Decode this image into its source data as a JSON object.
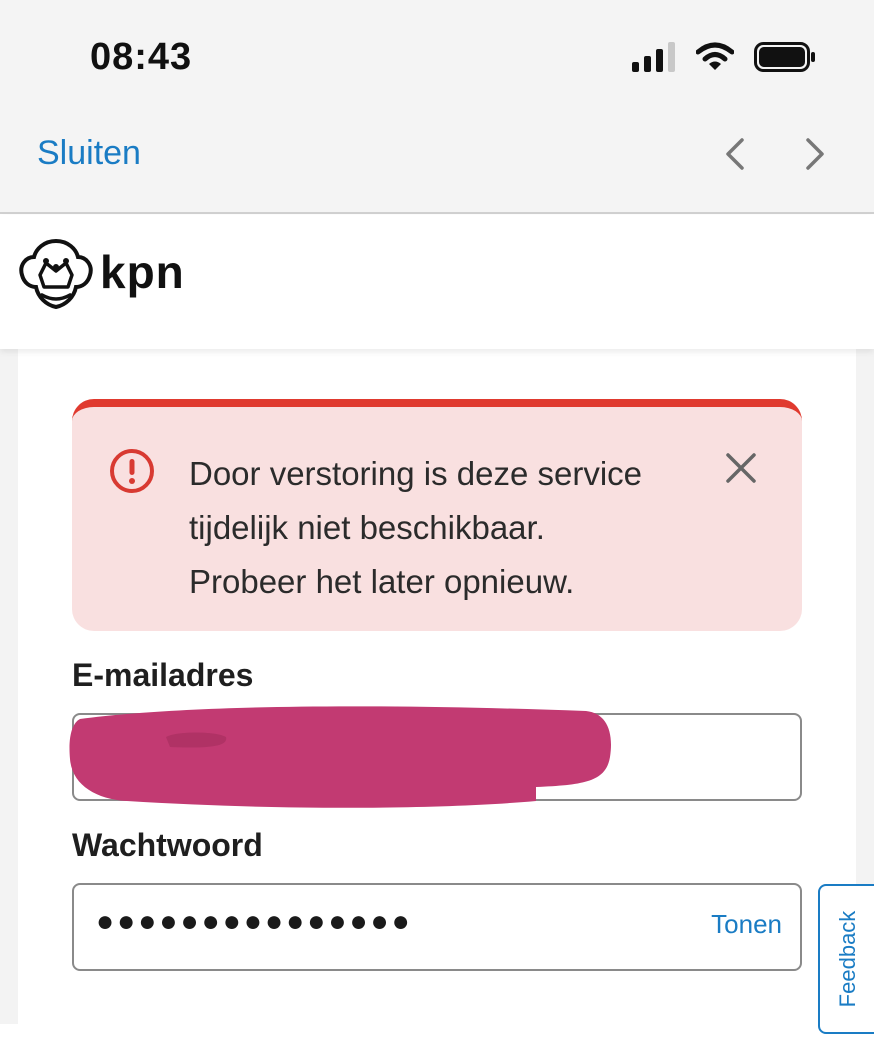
{
  "status_bar": {
    "time": "08:43"
  },
  "nav": {
    "close_label": "Sluiten"
  },
  "brand": {
    "logo_text": "kpn"
  },
  "alert": {
    "line1": "Door verstoring is deze service",
    "line2": "tijdelijk niet beschikbaar.",
    "line3": "Probeer het later opnieuw.",
    "color": "#e03a2f",
    "background": "#f9e0e0"
  },
  "form": {
    "email_label": "E-mailadres",
    "password_label": "Wachtwoord",
    "password_value": "●●●●●●●●●●●●●●●",
    "show_password_label": "Tonen"
  },
  "feedback": {
    "label": "Feedback"
  },
  "colors": {
    "link": "#1a7cc4",
    "redaction": "#c23a72"
  }
}
